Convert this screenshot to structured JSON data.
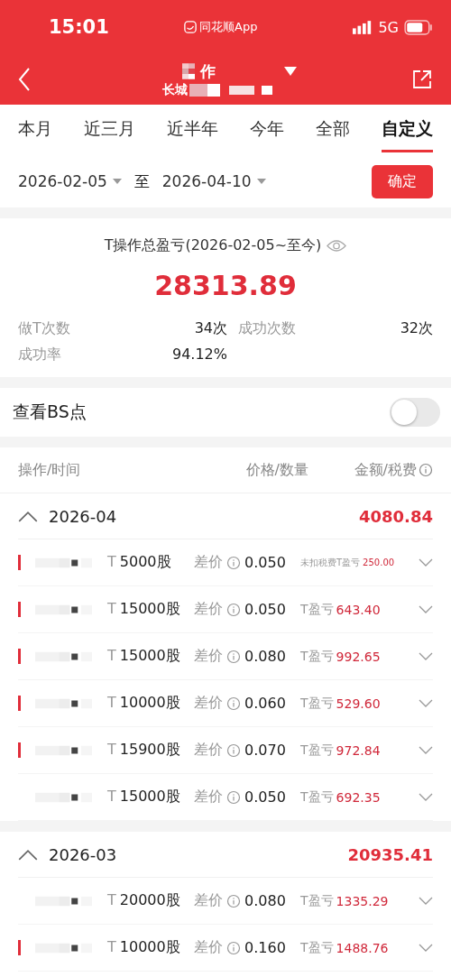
{
  "status_bar": {
    "time": "15:01",
    "app": "同花顺App",
    "network": "5G"
  },
  "nav": {
    "title": "作",
    "subtitle": "长城"
  },
  "tabs": [
    {
      "label": "本月",
      "selected": false
    },
    {
      "label": "近三月",
      "selected": false
    },
    {
      "label": "近半年",
      "selected": false
    },
    {
      "label": "今年",
      "selected": false
    },
    {
      "label": "全部",
      "selected": false
    },
    {
      "label": "自定义",
      "selected": true
    }
  ],
  "date_range": {
    "start": "2026-02-05",
    "separator": "至",
    "end": "2026-04-10",
    "confirm": "确定"
  },
  "summary": {
    "title": "T操作总盈亏(2026-02-05~至今)",
    "total": "28313.89",
    "stats": [
      {
        "label": "做T次数",
        "value": "34次"
      },
      {
        "label": "成功次数",
        "value": "32次"
      },
      {
        "label": "成功率",
        "value": "94.12%"
      }
    ]
  },
  "bs_points": {
    "label": "查看BS点",
    "on": false
  },
  "table": {
    "columns": [
      "操作/时间",
      "价格/数量",
      "金额/税费"
    ],
    "groups": [
      {
        "month": "2026-04",
        "total": "4080.84",
        "expanded": true,
        "rows": [
          {
            "kind": "pretax",
            "marked": true,
            "type": "T",
            "qty": "5000股",
            "diff_label": "差价",
            "diff": "0.050",
            "pl_label": "未扣税费T盈亏",
            "pl": "250.00"
          },
          {
            "kind": "net",
            "marked": true,
            "type": "T",
            "qty": "15000股",
            "diff_label": "差价",
            "diff": "0.050",
            "pl_label": "T盈亏",
            "pl": "643.40"
          },
          {
            "kind": "net",
            "marked": true,
            "type": "T",
            "qty": "15000股",
            "diff_label": "差价",
            "diff": "0.080",
            "pl_label": "T盈亏",
            "pl": "992.65"
          },
          {
            "kind": "net",
            "marked": true,
            "type": "T",
            "qty": "10000股",
            "diff_label": "差价",
            "diff": "0.060",
            "pl_label": "T盈亏",
            "pl": "529.60"
          },
          {
            "kind": "net",
            "marked": true,
            "type": "T",
            "qty": "15900股",
            "diff_label": "差价",
            "diff": "0.070",
            "pl_label": "T盈亏",
            "pl": "972.84"
          },
          {
            "kind": "net",
            "marked": false,
            "type": "T",
            "qty": "15000股",
            "diff_label": "差价",
            "diff": "0.050",
            "pl_label": "T盈亏",
            "pl": "692.35"
          }
        ]
      },
      {
        "month": "2026-03",
        "total": "20935.41",
        "expanded": true,
        "rows": [
          {
            "kind": "net",
            "marked": false,
            "type": "T",
            "qty": "20000股",
            "diff_label": "差价",
            "diff": "0.080",
            "pl_label": "T盈亏",
            "pl": "1335.29"
          },
          {
            "kind": "net",
            "marked": true,
            "type": "T",
            "qty": "10000股",
            "diff_label": "差价",
            "diff": "0.160",
            "pl_label": "T盈亏",
            "pl": "1488.76"
          }
        ]
      }
    ]
  }
}
